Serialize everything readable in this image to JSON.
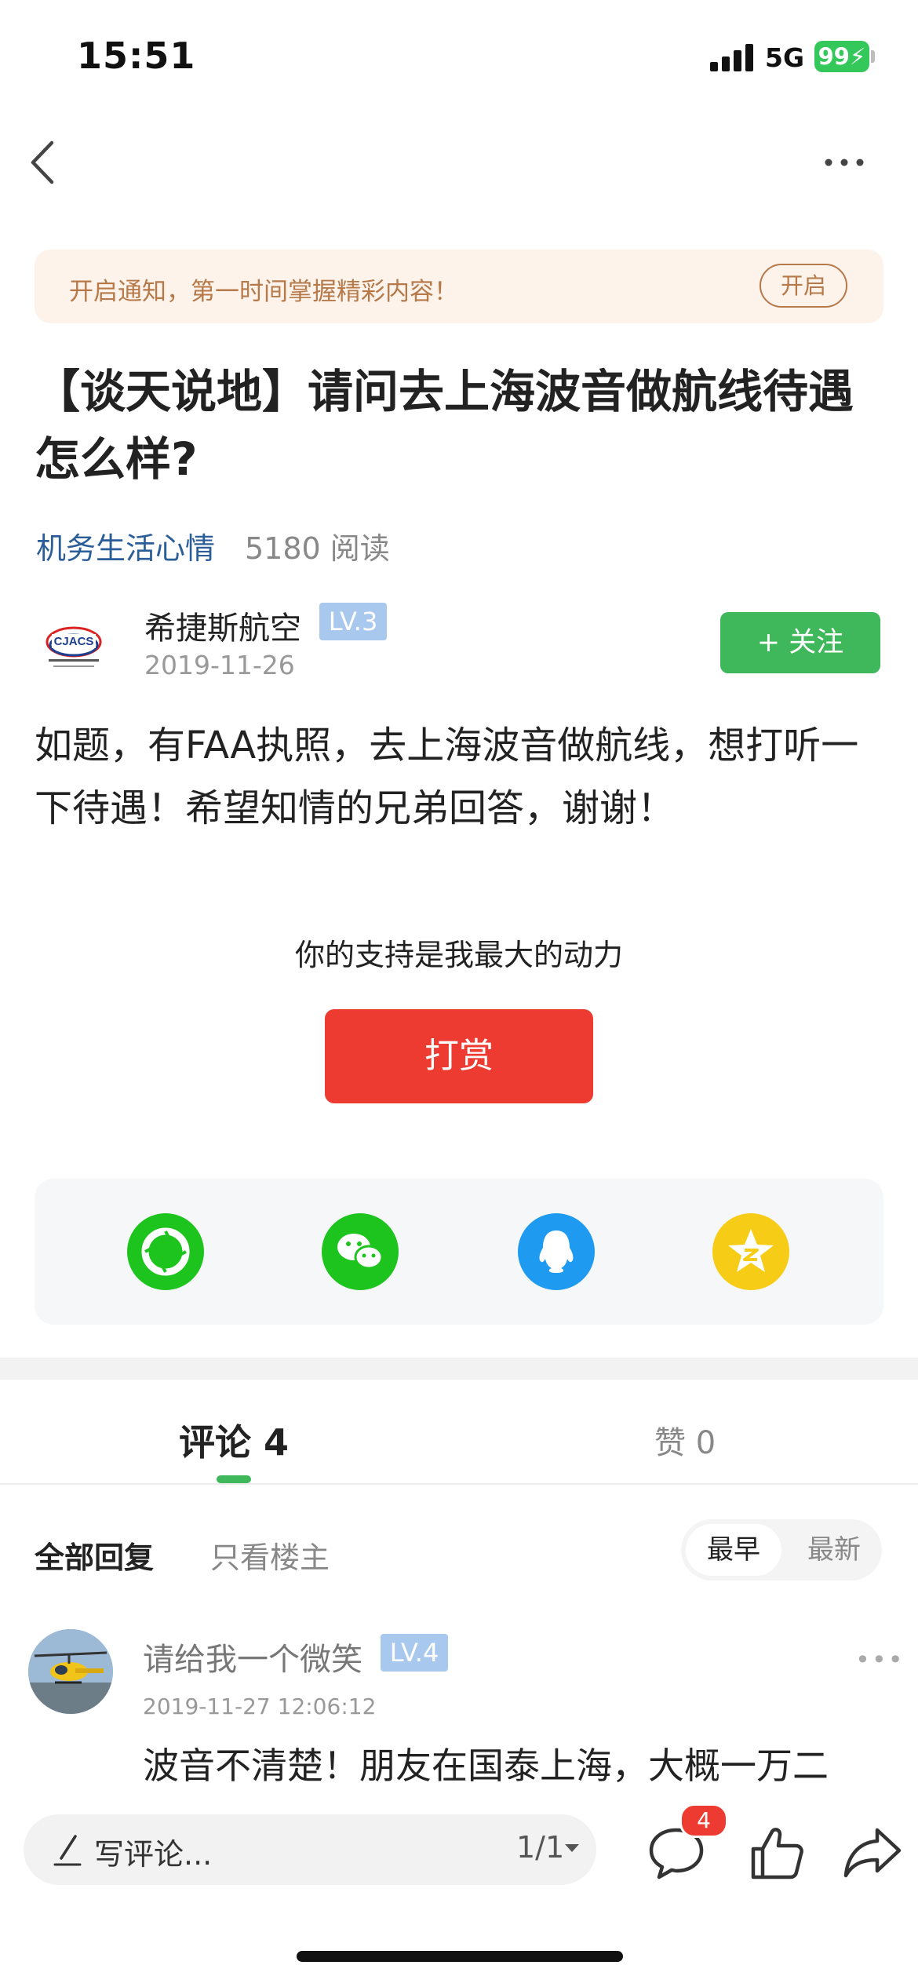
{
  "status_bar": {
    "time": "15:51",
    "network": "5G",
    "battery": "99"
  },
  "notify": {
    "text": "开启通知，第一时间掌握精彩内容！",
    "button": "开启"
  },
  "post": {
    "title": "【谈天说地】请问去上海波音做航线待遇怎么样?",
    "category": "机务生活心情",
    "reads": "5180 阅读",
    "author": {
      "name": "希捷斯航空",
      "level": "LV.3",
      "date": "2019-11-26",
      "logo_text": "CJACS"
    },
    "follow_label": "+ 关注",
    "body": "如题，有FAA执照，去上海波音做航线，想打听一下待遇！希望知情的兄弟回答，谢谢！"
  },
  "support": {
    "text": "你的支持是我最大的动力",
    "button": "打赏"
  },
  "share": [
    {
      "name": "moments-icon",
      "color": "#1ec41e"
    },
    {
      "name": "wechat-icon",
      "color": "#1ec41e"
    },
    {
      "name": "qq-icon",
      "color": "#1e9bf0"
    },
    {
      "name": "qzone-icon",
      "color": "#f7cc16"
    }
  ],
  "tabs": {
    "comments": "评论 4",
    "likes": "赞 0"
  },
  "filters": {
    "all": "全部回复",
    "op_only": "只看楼主",
    "earliest": "最早",
    "newest": "最新"
  },
  "comments": [
    {
      "user": "请给我一个微笑",
      "level": "LV.4",
      "date": "2019-11-27 12:06:12",
      "text": "波音不清楚！朋友在国泰上海，大概一万二"
    }
  ],
  "bottom_bar": {
    "input_placeholder": "写评论...",
    "page": "1/1",
    "comment_count": "4"
  },
  "colors": {
    "accent_green": "#3eb85a",
    "reward_red": "#ee3b32",
    "link_blue": "#2b5e99"
  }
}
